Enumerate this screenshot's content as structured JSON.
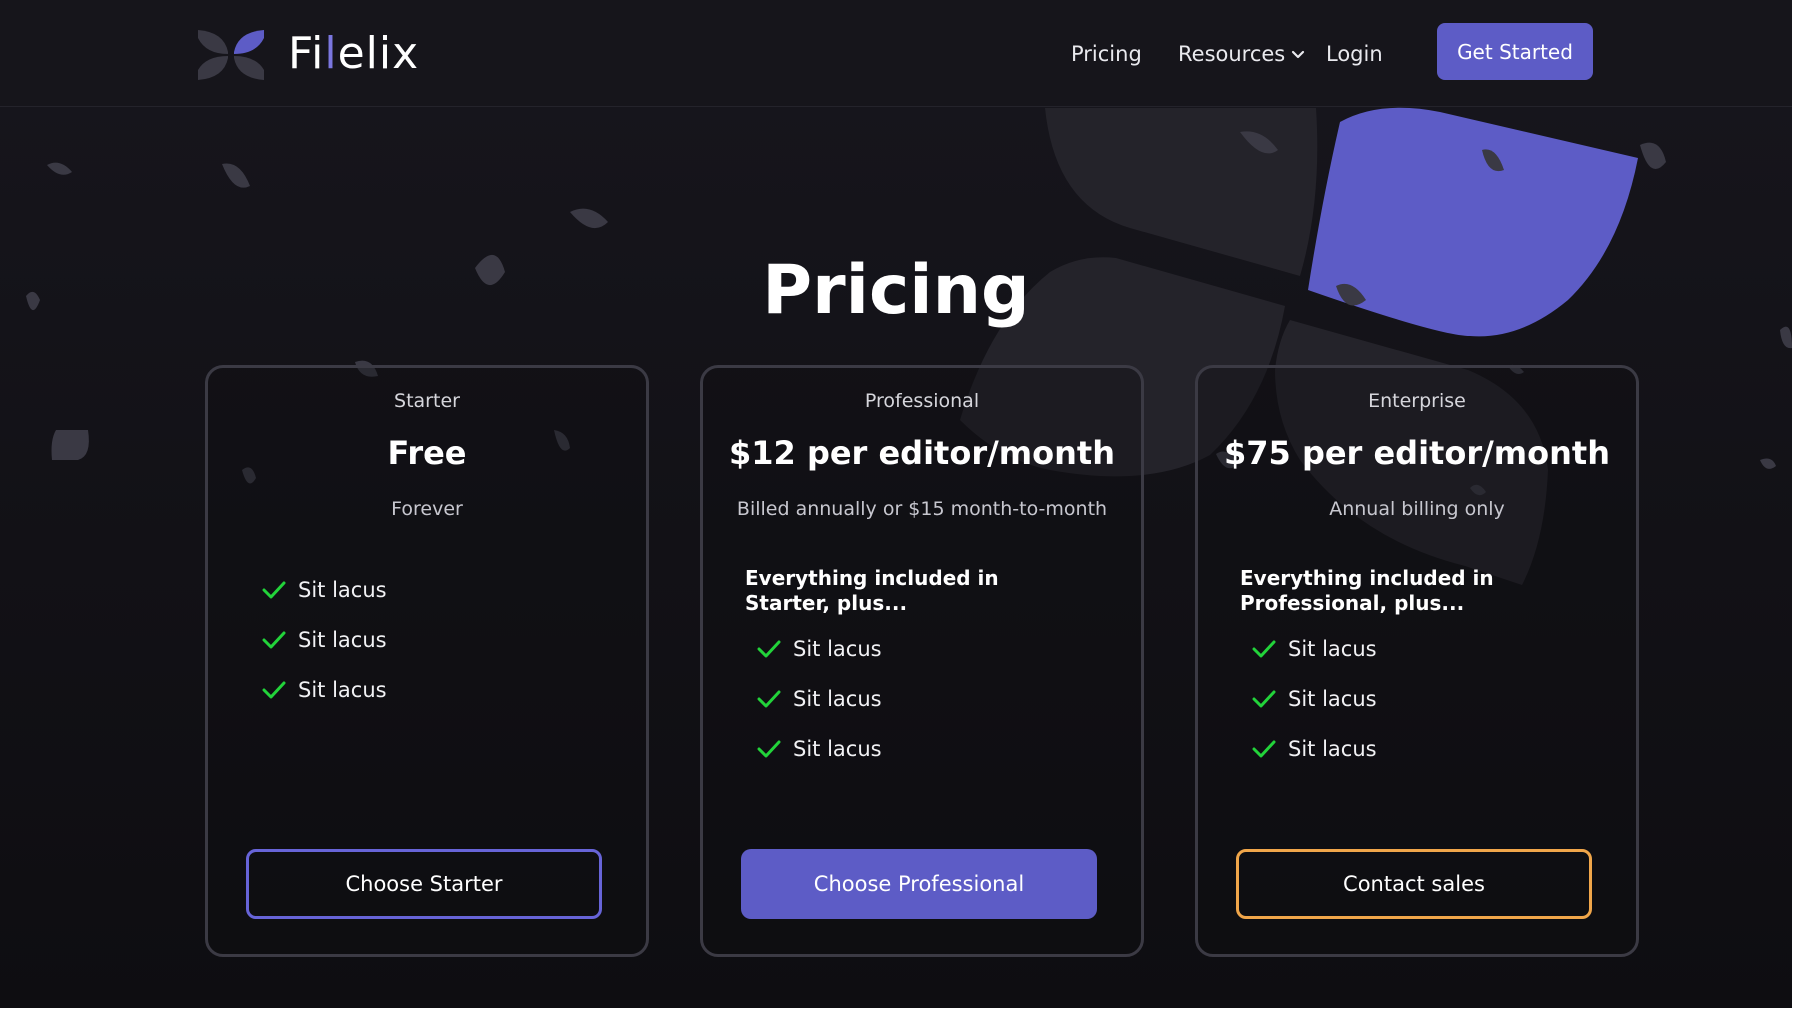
{
  "header": {
    "brand": {
      "part1": "Fi",
      "part2": "l",
      "part3": "elix"
    },
    "nav": {
      "pricing": "Pricing",
      "resources": "Resources",
      "login": "Login"
    },
    "cta": "Get Started"
  },
  "main": {
    "title": "Pricing",
    "plans": [
      {
        "tier": "Starter",
        "price": "Free",
        "billing": "Forever",
        "includes": "",
        "features": [
          "Sit lacus",
          "Sit lacus",
          "Sit lacus"
        ],
        "cta": "Choose Starter"
      },
      {
        "tier": "Professional",
        "price": "$12 per editor/month",
        "billing": "Billed annually or $15 month-to-month",
        "includes": "Everything included in Starter, plus...",
        "features": [
          "Sit lacus",
          "Sit lacus",
          "Sit lacus"
        ],
        "cta": "Choose Professional"
      },
      {
        "tier": "Enterprise",
        "price": "$75 per editor/month",
        "billing": "Annual billing only",
        "includes": "Everything included in Professional, plus...",
        "features": [
          "Sit lacus",
          "Sit lacus",
          "Sit lacus"
        ],
        "cta": "Contact sales"
      }
    ]
  },
  "icons": {
    "logo": "filelix-logo-icon",
    "dropdown": "chevron-down-icon",
    "check": "check-icon"
  },
  "colors": {
    "background": "#131218",
    "accent": "#5d5cc6",
    "accent_light": "#7b77e0",
    "check": "#22d33a",
    "enterprise_outline": "#f0a64a",
    "card_border": "#3b3a44"
  }
}
